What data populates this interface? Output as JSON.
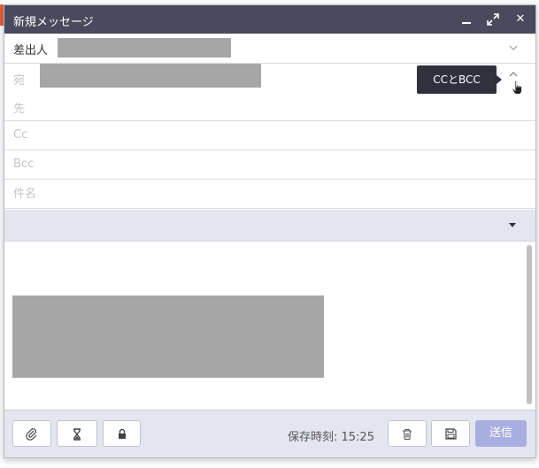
{
  "window": {
    "title": "新規メッセージ",
    "minimize_icon": "minimize-icon",
    "maximize_icon": "maximize-icon",
    "close_icon": "close-icon"
  },
  "fields": {
    "from_label": "差出人",
    "to_label_line1": "宛",
    "to_label_line2": "先",
    "cc_placeholder": "Cc",
    "bcc_placeholder": "Bcc",
    "subject_placeholder": "件名"
  },
  "tooltip": {
    "text": "CCとBCC"
  },
  "footer": {
    "saved_text": "保存時刻: 15:25",
    "send_label": "送信"
  },
  "colors": {
    "titlebar": "#4a4a5e",
    "send_button": "#a8aee0",
    "tooltip_bg": "#2f313c"
  }
}
